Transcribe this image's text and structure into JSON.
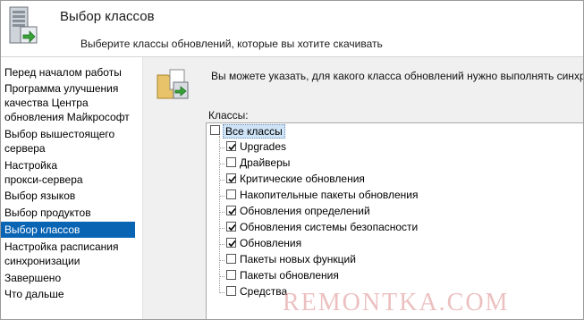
{
  "header": {
    "title": "Выбор классов",
    "subtitle": "Выберите классы обновлений, которые вы хотите скачивать",
    "icon": "server-sync-icon"
  },
  "sidebar": {
    "items": [
      {
        "label": "Перед началом работы",
        "selected": false
      },
      {
        "label": "Программа улучшения",
        "selected": false
      },
      {
        "label": "качества Центра",
        "selected": false
      },
      {
        "label": "обновления Майкрософт",
        "selected": false
      },
      {
        "label": "Выбор вышестоящего",
        "selected": false
      },
      {
        "label": "сервера",
        "selected": false
      },
      {
        "label": "Настройка",
        "selected": false
      },
      {
        "label": "прокси-сервера",
        "selected": false
      },
      {
        "label": "Выбор языков",
        "selected": false
      },
      {
        "label": "Выбор продуктов",
        "selected": false
      },
      {
        "label": "Выбор классов",
        "selected": true
      },
      {
        "label": "Настройка расписания",
        "selected": false
      },
      {
        "label": "синхронизации",
        "selected": false
      },
      {
        "label": "Завершено",
        "selected": false
      },
      {
        "label": "Что дальше",
        "selected": false
      }
    ]
  },
  "content": {
    "icon": "folder-package-icon",
    "description": "Вы можете указать, для какого класса обновлений нужно выполнять синхр",
    "classes_label": "Классы:",
    "tree": {
      "root": {
        "label": "Все классы",
        "checked": false
      },
      "items": [
        {
          "label": "Upgrades",
          "checked": true
        },
        {
          "label": "Драйверы",
          "checked": false
        },
        {
          "label": "Критические обновления",
          "checked": true
        },
        {
          "label": "Накопительные пакеты обновления",
          "checked": false
        },
        {
          "label": "Обновления определений",
          "checked": true
        },
        {
          "label": "Обновления системы безопасности",
          "checked": true
        },
        {
          "label": "Обновления",
          "checked": true
        },
        {
          "label": "Пакеты новых функций",
          "checked": false
        },
        {
          "label": "Пакеты обновления",
          "checked": false
        },
        {
          "label": "Средства",
          "checked": false
        }
      ]
    }
  },
  "watermark": "REMONTKA.COM",
  "colors": {
    "selection": "#0a64b4",
    "content_bg": "#f0f0f0"
  }
}
